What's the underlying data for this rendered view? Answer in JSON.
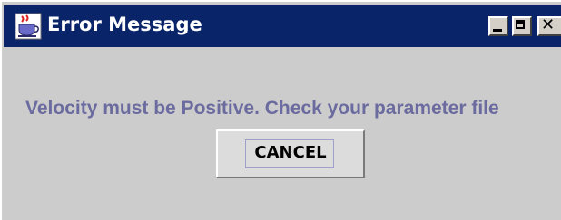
{
  "window": {
    "title": "Error Message",
    "icon": "java-cup-icon",
    "controls": {
      "minimize": "minimize-icon",
      "maximize": "maximize-icon",
      "close": "close-icon"
    }
  },
  "dialog": {
    "message": "Velocity must be Positive. Check your parameter file",
    "cancel_label": "CANCEL"
  },
  "colors": {
    "titlebar": "#0a246a",
    "background": "#cccccc",
    "message_text": "#6b6b9f"
  }
}
